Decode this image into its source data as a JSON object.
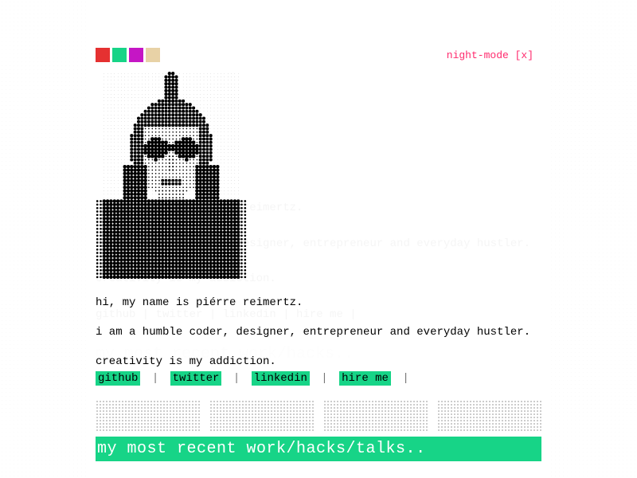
{
  "swatches": [
    "#e53131",
    "#17d487",
    "#c516c5",
    "#e8d2a6"
  ],
  "night_mode_label": "night-mode [x]",
  "intro": {
    "line1": "hi, my name is piérre reimertz.",
    "line2": "i am a humble coder, designer, entrepreneur and everyday hustler.",
    "line3": "creativity is my addiction."
  },
  "links": {
    "github": "github",
    "twitter": "twitter",
    "linkedin": "linkedin",
    "hire": "hire me",
    "separator": "|"
  },
  "section_heading": "my most recent work/hacks/talks..",
  "ghost": {
    "p1": "hi, my name is piérre reimertz.",
    "p2": "i am a humble coder, designer, entrepreneur and everyday hustler.",
    "p3": "creativity is my addiction.",
    "p4": "github | twitter | linkedin | hire me |",
    "heading": "my most recent work/hacks.."
  },
  "portrait_alt": "halftone-selfie"
}
